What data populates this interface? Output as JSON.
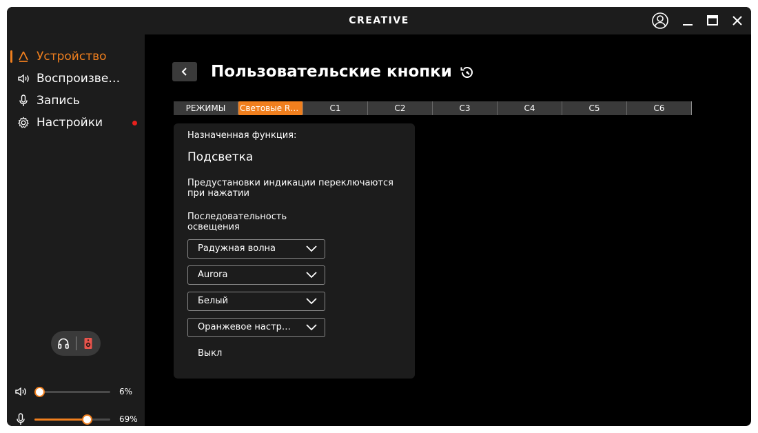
{
  "app": {
    "brand": "CREATIVE"
  },
  "colors": {
    "accent": "#f07f1e",
    "background": "#000000",
    "panel": "#1c1c1c",
    "notification": "#e8201c"
  },
  "titlebar": {
    "icons": [
      "user-account-icon",
      "minimize-icon",
      "maximize-icon",
      "close-icon"
    ]
  },
  "sidebar": {
    "items": [
      {
        "label": "Устройство",
        "icon": "device-icon",
        "active": true
      },
      {
        "label": "Воспроизведение",
        "icon": "speaker-icon",
        "active": false
      },
      {
        "label": "Запись",
        "icon": "microphone-icon",
        "active": false
      },
      {
        "label": "Настройки",
        "icon": "gear-icon",
        "active": false
      }
    ],
    "output_toggle": {
      "left_icon": "headphones-icon",
      "right_icon": "speaker-box-icon"
    },
    "playback_volume": {
      "value_label": "6%",
      "level": 0.06
    },
    "record_volume": {
      "value_label": "69%",
      "level": 0.69
    }
  },
  "main": {
    "title": "Пользовательские кнопки",
    "tabs": [
      {
        "label": "РЕЖИМЫ",
        "active": false
      },
      {
        "label": "Световые RGB",
        "active": true
      },
      {
        "label": "C1",
        "active": false
      },
      {
        "label": "C2",
        "active": false
      },
      {
        "label": "C3",
        "active": false
      },
      {
        "label": "C4",
        "active": false
      },
      {
        "label": "C5",
        "active": false
      },
      {
        "label": "C6",
        "active": false
      }
    ],
    "panel": {
      "assigned_label": "Назначенная функция:",
      "assigned_value": "Подсветка",
      "description": "Предустановки индикации переключаются при нажатии",
      "sequence_label": "Последовательность освещения",
      "dropdowns": [
        "Радужная волна",
        "Aurora",
        "Белый",
        "Оранжевое настроение"
      ],
      "off_item": "Выкл"
    }
  }
}
